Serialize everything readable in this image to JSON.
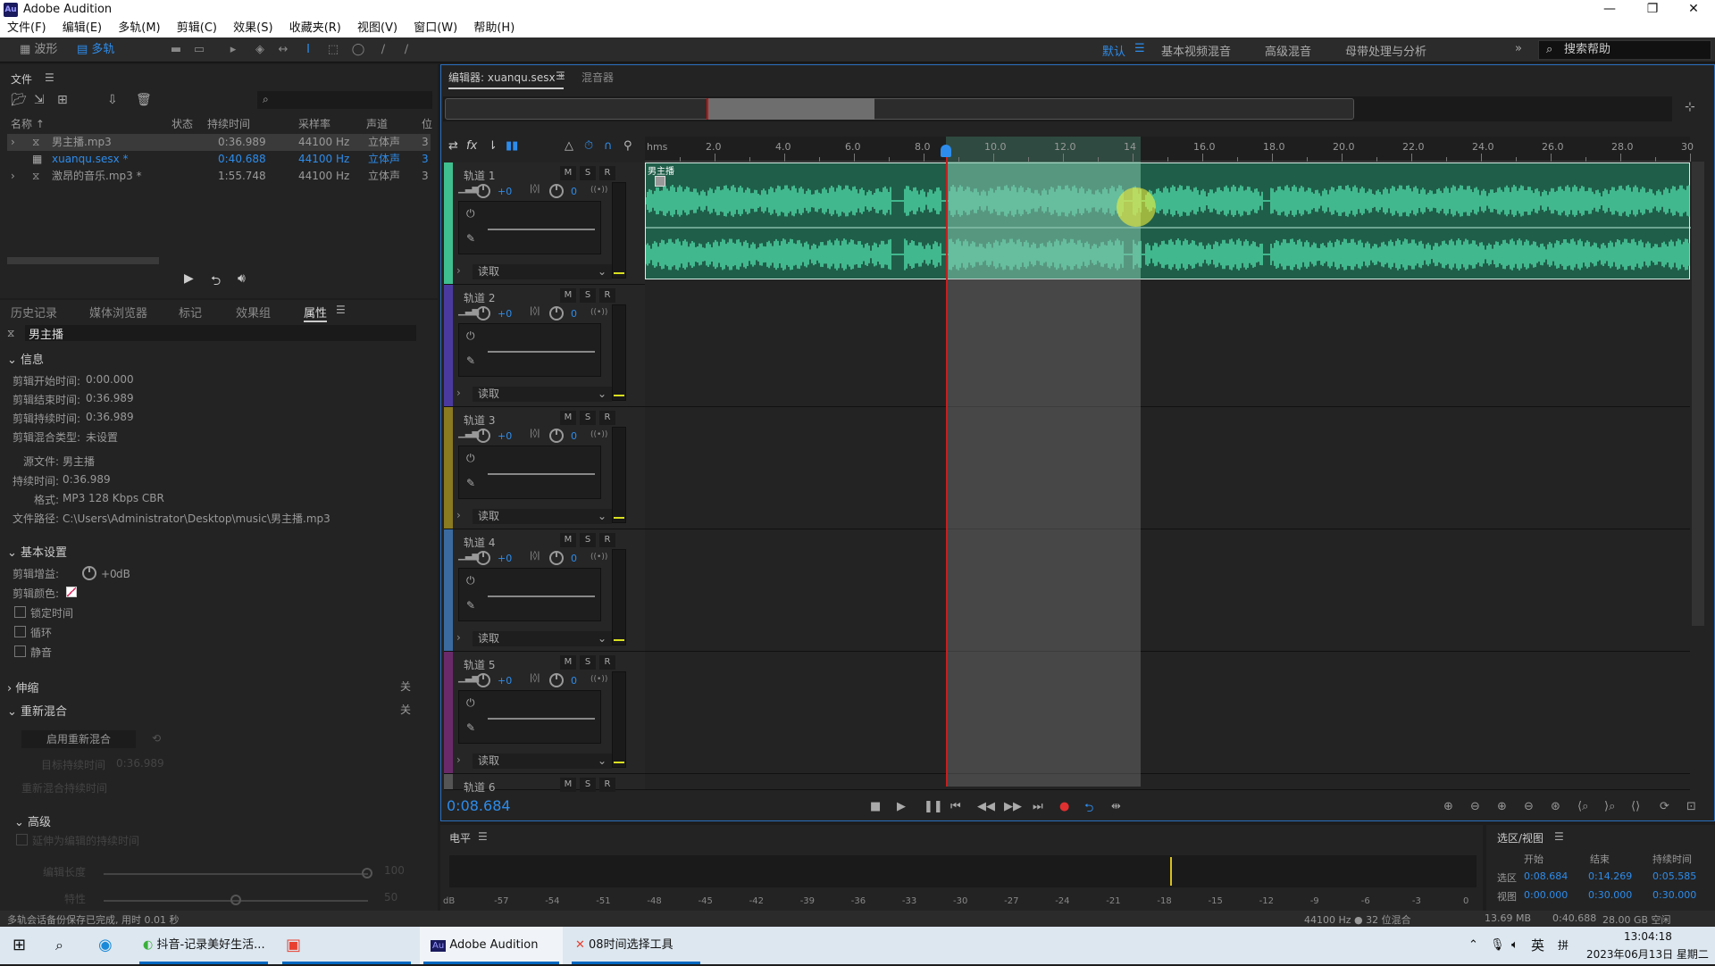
{
  "window": {
    "app_icon": "Au",
    "title": "Adobe Audition",
    "minimize": "—",
    "maximize": "❐",
    "close": "✕"
  },
  "menu": [
    "文件(F)",
    "编辑(E)",
    "多轨(M)",
    "剪辑(C)",
    "效果(S)",
    "收藏夹(R)",
    "视图(V)",
    "窗口(W)",
    "帮助(H)"
  ],
  "toolbar": {
    "waveform": "波形",
    "multitrack": "多轨"
  },
  "workspaces": {
    "active": "默认",
    "items": [
      "基本视频混音",
      "高级混音",
      "母带处理与分析"
    ],
    "more": "»",
    "search_placeholder": "搜索帮助"
  },
  "files": {
    "title": "文件",
    "columns": [
      "名称 ↑",
      "状态",
      "持续时间",
      "采样率",
      "声道",
      "位"
    ],
    "rows": [
      {
        "name": "男主播.mp3",
        "duration": "0:36.989",
        "rate": "44100 Hz",
        "channels": "立体声",
        "bits": "3",
        "selected": true
      },
      {
        "name": "xuanqu.sesx *",
        "duration": "0:40.688",
        "rate": "44100 Hz",
        "channels": "立体声",
        "bits": "3",
        "active": true
      },
      {
        "name": "激昂的音乐.mp3 *",
        "duration": "1:55.748",
        "rate": "44100 Hz",
        "channels": "立体声",
        "bits": "3"
      }
    ]
  },
  "lower_tabs": [
    "历史记录",
    "媒体浏览器",
    "标记",
    "效果组",
    "属性"
  ],
  "properties": {
    "clip_name": "男主播",
    "info_title": "信息",
    "info": [
      {
        "label": "剪辑开始时间:",
        "value": "0:00.000"
      },
      {
        "label": "剪辑结束时间:",
        "value": "0:36.989"
      },
      {
        "label": "剪辑持续时间:",
        "value": "0:36.989"
      },
      {
        "label": "剪辑混合类型:",
        "value": "未设置"
      }
    ],
    "source": [
      {
        "label": "源文件:",
        "value": "男主播"
      },
      {
        "label": "持续时间:",
        "value": "0:36.989"
      },
      {
        "label": "格式:",
        "value": "MP3 128 Kbps CBR"
      },
      {
        "label": "文件路径:",
        "value": "C:\\Users\\Administrator\\Desktop\\music\\男主播.mp3"
      }
    ],
    "basic_title": "基本设置",
    "gain_label": "剪辑增益:",
    "gain_value": "+0",
    "gain_unit": "dB",
    "color_label": "剪辑颜色:",
    "checkboxes": [
      "锁定时间",
      "循环",
      "静音"
    ],
    "stretch": "伸缩",
    "stretch_state": "关",
    "remix": "重新混合",
    "remix_state": "关",
    "remix_button": "启用重新混合",
    "target_duration": "目标持续时间",
    "target_value": "0:36.989",
    "remix_duration": "重新混合持续时间",
    "advanced": "高级",
    "adv_check": "延伸为编辑的持续时间",
    "slider1": "编辑长度",
    "slider1_val": "100",
    "slider2": "特性",
    "slider2_val": "50"
  },
  "editor": {
    "tab": "编辑器: xuanqu.sesx *",
    "mixer": "混音器",
    "ruler_unit": "hms",
    "ruler": [
      "2.0",
      "4.0",
      "6.0",
      "8.0",
      "10.0",
      "12.0",
      "14",
      "16.0",
      "18.0",
      "20.0",
      "22.0",
      "24.0",
      "26.0",
      "28.0",
      "30"
    ],
    "clip_name": "男主播",
    "tracks": [
      {
        "name": "轨道 1",
        "vol": "+0",
        "pan": "0",
        "mode": "读取",
        "color": "#3fbf8f"
      },
      {
        "name": "轨道 2",
        "vol": "+0",
        "pan": "0",
        "mode": "读取",
        "color": "#4a3aa0"
      },
      {
        "name": "轨道 3",
        "vol": "+0",
        "pan": "0",
        "mode": "读取",
        "color": "#8a7a20"
      },
      {
        "name": "轨道 4",
        "vol": "+0",
        "pan": "0",
        "mode": "读取",
        "color": "#3a6aa0"
      },
      {
        "name": "轨道 5",
        "vol": "+0",
        "pan": "0",
        "mode": "读取",
        "color": "#6a2a6a"
      },
      {
        "name": "轨道 6"
      }
    ],
    "msr": [
      "M",
      "S",
      "R"
    ],
    "current_time": "0:08.684"
  },
  "levels": {
    "title": "电平",
    "scale": [
      "dB",
      "-57",
      "-54",
      "-51",
      "-48",
      "-45",
      "-42",
      "-39",
      "-36",
      "-33",
      "-30",
      "-27",
      "-24",
      "-21",
      "-18",
      "-15",
      "-12",
      "-9",
      "-6",
      "-3",
      "0"
    ]
  },
  "selview": {
    "title": "选区/视图",
    "cols": [
      "开始",
      "结束",
      "持续时间"
    ],
    "rows": [
      {
        "label": "选区",
        "start": "0:08.684",
        "end": "0:14.269",
        "dur": "0:05.585"
      },
      {
        "label": "视图",
        "start": "0:00.000",
        "end": "0:30.000",
        "dur": "0:30.000"
      }
    ]
  },
  "status": {
    "message": "多轨会话备份保存已完成, 用时 0.01 秒",
    "format": "44100 Hz ● 32 位混合",
    "size": "13.69 MB",
    "duration": "0:40.688",
    "free": "28.00 GB 空闲"
  },
  "taskbar": {
    "apps": [
      "抖音-记录美好生活...",
      "Adobe Audition",
      "08时间选择工具"
    ],
    "tray": {
      "lang": "英",
      "ime": "拼",
      "time": "13:04:18",
      "date": "2023年06月13日 星期二"
    }
  }
}
